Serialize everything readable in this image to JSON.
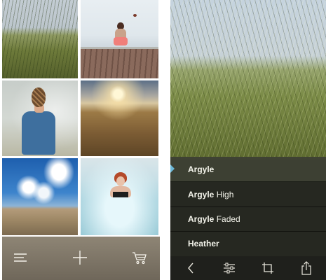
{
  "filters": [
    {
      "name": "Argyle",
      "variant": ""
    },
    {
      "name": "Argyle",
      "variant": "High"
    },
    {
      "name": "Argyle",
      "variant": "Faded"
    },
    {
      "name": "Heather",
      "variant": ""
    }
  ],
  "selected_filter_index": 0,
  "colors": {
    "indicator": "#6cb8d8",
    "toolbar_left": "#7b7365",
    "toolbar_right": "#1f201c",
    "filter_panel": "#262821"
  },
  "icons": {
    "left_toolbar": [
      "menu-icon",
      "plus-icon",
      "cart-icon"
    ],
    "right_toolbar": [
      "back-icon",
      "adjust-icon",
      "crop-icon",
      "share-icon"
    ]
  }
}
